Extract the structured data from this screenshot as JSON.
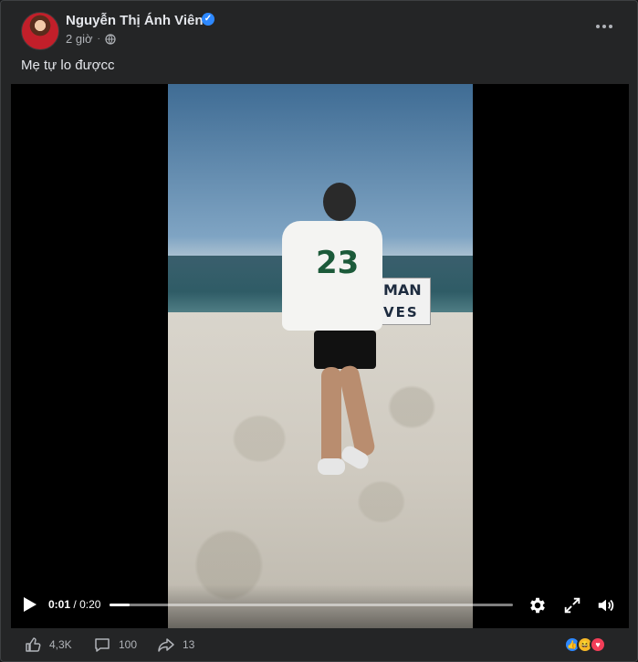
{
  "post": {
    "author": "Nguyễn Thị Ánh Viên",
    "time": "2 giờ",
    "separator": "·",
    "caption": "Mẹ tự lo đượcc"
  },
  "video": {
    "time_current": "0:01",
    "time_separator": "/",
    "time_total": "0:20",
    "progress_fraction": 0.05,
    "sign_top": "MAN",
    "sign_bottom": "VES",
    "shirt_number": "23"
  },
  "footer": {
    "likes": "4,3K",
    "comments": "100",
    "shares": "13"
  },
  "colors": {
    "accent": "#2d88ff",
    "background": "#242526",
    "text": "#e4e6eb",
    "secondary_text": "#b0b3b8"
  },
  "icons": [
    "verified-badge-icon",
    "globe-icon",
    "more-options-icon",
    "play-icon",
    "settings-icon",
    "fullscreen-icon",
    "volume-icon",
    "like-icon",
    "comment-icon",
    "share-icon",
    "like-reaction-icon",
    "haha-reaction-icon",
    "love-reaction-icon"
  ]
}
